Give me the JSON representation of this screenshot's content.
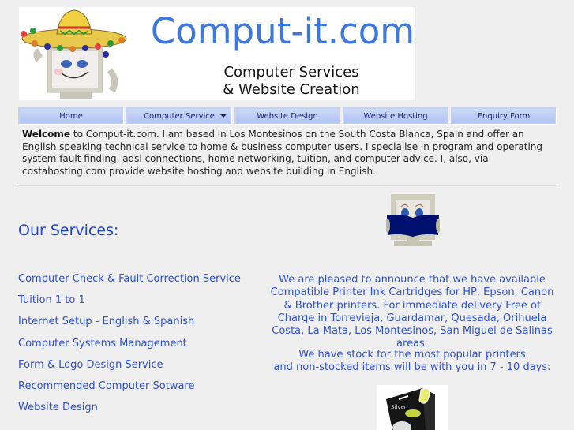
{
  "banner": {
    "brand": "Comput-it.com",
    "tagline_line1": "Computer Services",
    "tagline_line2": "& Website Creation",
    "mascot_icon": "sombrero-computer-mascot"
  },
  "nav": {
    "items": [
      {
        "label": "Home",
        "has_dropdown": false
      },
      {
        "label": "Computer Service",
        "has_dropdown": true
      },
      {
        "label": "Website Design",
        "has_dropdown": false
      },
      {
        "label": "Website Hosting",
        "has_dropdown": false
      },
      {
        "label": "Enquiry Form",
        "has_dropdown": false
      }
    ]
  },
  "intro": {
    "bold": "Welcome",
    "text": " to Comput-it.com. I am based in Los Montesinos on the South Costa Blanca, Spain and offer an English speaking technical service to home & business computer users. I specialise in program and operating system fault finding, adsl connections, home networking, tuition, and computer advice. I, also, via costahosting.com provide website hosting and website building in English."
  },
  "services": {
    "heading": "Our Services:",
    "reader_icon": "computer-reading-book",
    "items": [
      "Computer Check & Fault Correction Service",
      "Tuition 1 to 1",
      "Internet Setup - English & Spanish",
      "Computer Systems Management",
      "Form & Logo Design Service",
      "Recommended Computer Sotware",
      "Website Design"
    ]
  },
  "promo": {
    "announcement": "We are pleased to announce that we have available Compatible Printer Ink Cartridges for HP, Epson, Canon & Brother printers. For immediate delivery Free of Charge in Torrevieja, Guardamar, Quesada, Orihuela Costa, La Mata, Los Montesinos, San Miguel de Salinas areas.",
    "stock_line1": "We have stock for the most popular printers",
    "stock_line2": "and non-stocked items will be with you in 7 - 10 days:",
    "product_image": "silver-ink-cartridge-box"
  },
  "colors": {
    "brand_blue": "#3f78dc",
    "link_blue": "#2e4fd0",
    "heading_blue": "#1f44c8",
    "nav_bg": "#b9cbf5",
    "nav_text": "#1a2c78",
    "page_bg": "#efefef"
  }
}
